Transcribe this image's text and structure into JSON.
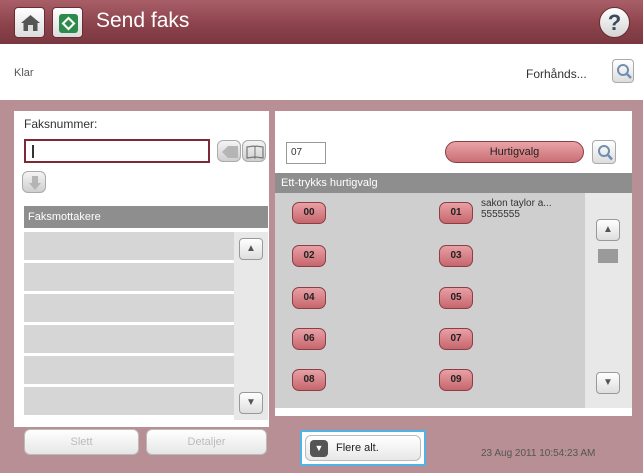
{
  "titlebar": {
    "title": "Send faks"
  },
  "status": {
    "state": "Klar",
    "preview_label": "Forhånds..."
  },
  "fax_entry": {
    "label": "Faksnummer:",
    "value": ""
  },
  "recipients": {
    "header": "Faksmottakere",
    "rows": [
      "",
      "",
      "",
      "",
      "",
      ""
    ],
    "delete_label": "Slett",
    "details_label": "Detaljer"
  },
  "speed_dial": {
    "number_value": "07",
    "button_label": "Hurtigvalg",
    "one_touch_header": "Ett-trykks hurtigvalg",
    "keys": [
      {
        "id": "00",
        "name": ""
      },
      {
        "id": "01",
        "name": "sakon taylor a...",
        "number": "5555555"
      },
      {
        "id": "02",
        "name": ""
      },
      {
        "id": "03",
        "name": ""
      },
      {
        "id": "04",
        "name": ""
      },
      {
        "id": "05",
        "name": ""
      },
      {
        "id": "06",
        "name": ""
      },
      {
        "id": "07",
        "name": ""
      },
      {
        "id": "08",
        "name": ""
      },
      {
        "id": "09",
        "name": ""
      }
    ]
  },
  "footer": {
    "more_options": "Flere alt.",
    "datetime": "23 Aug 2011 10:54:23 AM"
  },
  "icons": {
    "home": "home-icon",
    "send": "send-fax-icon",
    "help": "help-icon",
    "preview": "magnifier-icon",
    "backspace": "backspace-icon",
    "phonebook": "book-icon",
    "add": "down-arrow-icon"
  },
  "colors": {
    "titlebar": "#8c434c",
    "accent_key": "#c7666d",
    "highlight": "#4fb3e6",
    "panel_bg": "#b88f94"
  }
}
